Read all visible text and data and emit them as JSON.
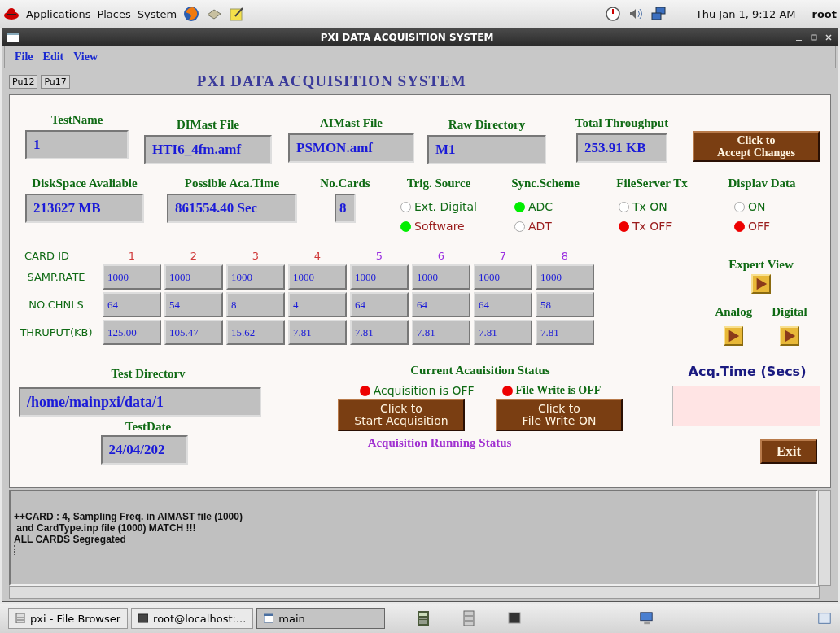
{
  "top_panel": {
    "menus": [
      "Applications",
      "Places",
      "System"
    ],
    "clock": "Thu Jan  1,  9:12 AM",
    "user": "root"
  },
  "window": {
    "title": "PXI DATA ACQUISITION SYSTEM"
  },
  "menu_bar": [
    "File",
    "Edit",
    "View"
  ],
  "toolbar": {
    "buttons": [
      "Pu12",
      "Pu17"
    ],
    "heading": "PXI DATA ACQUISITION SYSTEM"
  },
  "files": [
    {
      "label": "TestName",
      "value": "1"
    },
    {
      "label": "DIMast File",
      "value": "HTI6_4fm.amf"
    },
    {
      "label": "AIMast File",
      "value": "PSMON.amf"
    },
    {
      "label": "Raw Directory",
      "value": "M1"
    },
    {
      "label": "Total Throughput",
      "value": "253.91 KB"
    }
  ],
  "accept_button": "Click to\nAccept Changes",
  "info": [
    {
      "label": "DiskSpace Avaliable",
      "value": "213627 MB"
    },
    {
      "label": "Possible Aca.Time",
      "value": "861554.40 Sec"
    },
    {
      "label": "No.Cards",
      "value": "8"
    }
  ],
  "radio_groups": [
    {
      "label": "Trig. Source",
      "color": "#00ee00",
      "options": [
        {
          "label": "Ext. Digital",
          "selected": false
        },
        {
          "label": "Software",
          "selected": true
        }
      ]
    },
    {
      "label": "Sync.Scheme",
      "color": "#00ee00",
      "options": [
        {
          "label": "ADC",
          "selected": true
        },
        {
          "label": "ADT",
          "selected": false
        }
      ]
    },
    {
      "label": "FileServer Tx",
      "color": "#ee0000",
      "options": [
        {
          "label": "Tx ON",
          "selected": false
        },
        {
          "label": "Tx OFF",
          "selected": true
        }
      ]
    },
    {
      "label": "Displav Data",
      "color": "#ee0000",
      "options": [
        {
          "label": "ON",
          "selected": false
        },
        {
          "label": "OFF",
          "selected": true
        }
      ]
    }
  ],
  "cards": {
    "header": "CARD ID",
    "ids": [
      {
        "label": "1",
        "color": "#d03a3a"
      },
      {
        "label": "2",
        "color": "#d03a3a"
      },
      {
        "label": "3",
        "color": "#d03a3a"
      },
      {
        "label": "4",
        "color": "#d03a3a"
      },
      {
        "label": "5",
        "color": "#9a30e0"
      },
      {
        "label": "6",
        "color": "#9a30e0"
      },
      {
        "label": "7",
        "color": "#9a30e0"
      },
      {
        "label": "8",
        "color": "#9a30e0"
      }
    ],
    "rows": [
      {
        "label": "SAMP.RATE",
        "values": [
          "1000",
          "1000",
          "1000",
          "1000",
          "1000",
          "1000",
          "1000",
          "1000"
        ]
      },
      {
        "label": "NO.CHNLS",
        "values": [
          "64",
          "54",
          "8",
          "4",
          "64",
          "64",
          "64",
          "58"
        ]
      },
      {
        "label": "THRUPUT(KB)",
        "values": [
          "125.00",
          "105.47",
          "15.62",
          "7.81",
          "7.81",
          "7.81",
          "7.81",
          "7.81"
        ]
      }
    ]
  },
  "views": {
    "expert": "Expert View",
    "analog": "Analog",
    "digital": "Digital"
  },
  "test_directory": {
    "label": "Test Directorv",
    "value": "/home/mainpxi/data/1"
  },
  "test_date": {
    "label": "TestDate",
    "value": "24/04/202"
  },
  "status": {
    "heading": "Current Acauisition Status",
    "indicators": [
      {
        "label": "Acquisition is OFF",
        "on": false
      },
      {
        "label": "File Write is OFF",
        "on": false
      }
    ],
    "buttons": [
      "Click to\nStart Acquisition",
      "Click to\nFile Write ON"
    ],
    "running": "Acquisition Running Status"
  },
  "acq_time": {
    "label": "Acq.Time (Secs)"
  },
  "exit_button": "Exit",
  "log": [
    "++CARD : 4, Sampling Freq. in AIMAST file (1000)",
    " and CardType.inp file (1000) MATCH !!!",
    "ALL CARDS Segregated"
  ],
  "taskbar": [
    {
      "label": "pxi - File Browser",
      "kind": "folder",
      "selected": false
    },
    {
      "label": "root@localhost:...",
      "kind": "terminal",
      "selected": false
    },
    {
      "label": "main",
      "kind": "window",
      "selected": true
    }
  ]
}
